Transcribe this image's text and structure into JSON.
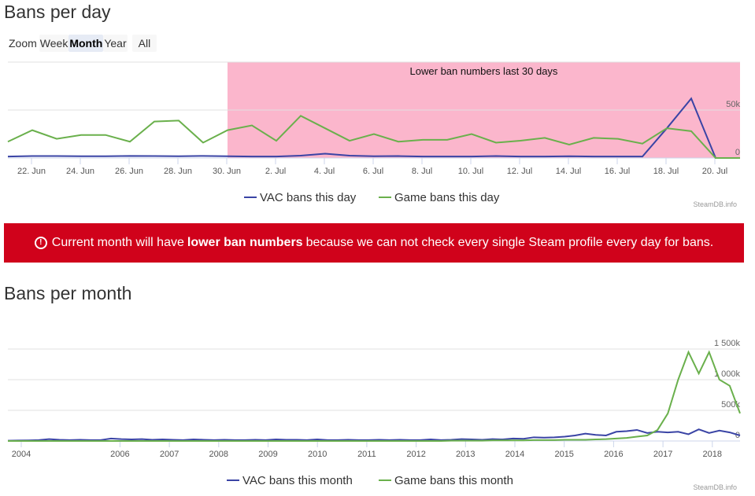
{
  "daily": {
    "title": "Bans per day",
    "zoom": {
      "label": "Zoom",
      "options": [
        "Week",
        "Month",
        "Year",
        "All"
      ],
      "selected": "Month"
    },
    "credit": "SteamDB.info",
    "chart_data": {
      "type": "line",
      "x_start": "2018-06-21",
      "band": {
        "from": "30. Jun",
        "to": "21. Jul",
        "label": "Lower ban numbers last 30 days",
        "color": "#fbb6cc"
      },
      "xticks": [
        "22. Jun",
        "24. Jun",
        "26. Jun",
        "28. Jun",
        "30. Jun",
        "2. Jul",
        "4. Jul",
        "6. Jul",
        "8. Jul",
        "10. Jul",
        "12. Jul",
        "14. Jul",
        "16. Jul",
        "18. Jul",
        "20. Jul"
      ],
      "yticks": [
        "0",
        "50k"
      ],
      "ylim": [
        0,
        100000
      ],
      "series": [
        {
          "name": "VAC bans this day",
          "color": "#3a44a5",
          "values": [
            1500,
            2000,
            2000,
            1800,
            1800,
            2200,
            2000,
            1800,
            2200,
            1800,
            1500,
            1500,
            2500,
            4500,
            2500,
            1800,
            2000,
            1500,
            1500,
            1500,
            2000,
            1500,
            1500,
            1800,
            1500,
            1500,
            1500,
            31000,
            62000,
            0,
            0
          ]
        },
        {
          "name": "Game bans this day",
          "color": "#6ab04c",
          "values": [
            17000,
            29000,
            20000,
            24000,
            24000,
            17000,
            38000,
            39000,
            16000,
            29000,
            34000,
            18000,
            44000,
            31000,
            18000,
            25000,
            17000,
            19000,
            19000,
            25000,
            16000,
            18000,
            21000,
            14000,
            21000,
            20000,
            15000,
            31000,
            28000,
            0,
            0
          ]
        }
      ]
    }
  },
  "notice": {
    "icon": "alert-circle-icon",
    "pre": "Current month will have",
    "bold": "lower ban numbers",
    "post": "because we can not check every single Steam profile every day for bans."
  },
  "monthly": {
    "title": "Bans per month",
    "credit": "SteamDB.info",
    "chart_data": {
      "type": "line",
      "x_start": 2003.75,
      "x_step": 0.25,
      "xticks": [
        "2004",
        "2006",
        "2007",
        "2008",
        "2009",
        "2010",
        "2011",
        "2012",
        "2013",
        "2014",
        "2015",
        "2016",
        "2017",
        "2018"
      ],
      "yticks": [
        "0",
        "500k",
        "1 000k",
        "1 500k"
      ],
      "ylim": [
        0,
        1500000
      ],
      "series": [
        {
          "name": "VAC bans this month",
          "color": "#3a44a5",
          "values": [
            5000,
            8000,
            10000,
            15000,
            30000,
            20000,
            15000,
            20000,
            15000,
            15000,
            40000,
            30000,
            25000,
            30000,
            20000,
            25000,
            20000,
            15000,
            25000,
            20000,
            15000,
            20000,
            15000,
            15000,
            20000,
            15000,
            25000,
            20000,
            20000,
            15000,
            25000,
            15000,
            15000,
            20000,
            15000,
            15000,
            20000,
            15000,
            20000,
            15000,
            15000,
            25000,
            15000,
            20000,
            30000,
            25000,
            20000,
            30000,
            25000,
            40000,
            35000,
            60000,
            55000,
            60000,
            70000,
            90000,
            120000,
            100000,
            90000,
            150000,
            160000,
            180000,
            130000,
            150000,
            140000,
            150000,
            110000,
            190000,
            130000,
            170000,
            140000,
            90000
          ]
        },
        {
          "name": "Game bans this month",
          "color": "#6ab04c",
          "values": [
            0,
            0,
            0,
            0,
            0,
            0,
            0,
            0,
            0,
            0,
            0,
            0,
            0,
            0,
            0,
            0,
            0,
            0,
            0,
            0,
            0,
            0,
            0,
            0,
            0,
            0,
            0,
            0,
            0,
            0,
            0,
            0,
            0,
            0,
            0,
            0,
            0,
            0,
            0,
            0,
            0,
            0,
            0,
            5000,
            5000,
            5000,
            5000,
            10000,
            10000,
            10000,
            10000,
            15000,
            15000,
            15000,
            20000,
            20000,
            20000,
            25000,
            30000,
            40000,
            50000,
            70000,
            90000,
            180000,
            450000,
            1000000,
            1450000,
            1100000,
            1450000,
            1000000,
            900000,
            450000
          ]
        }
      ]
    }
  }
}
